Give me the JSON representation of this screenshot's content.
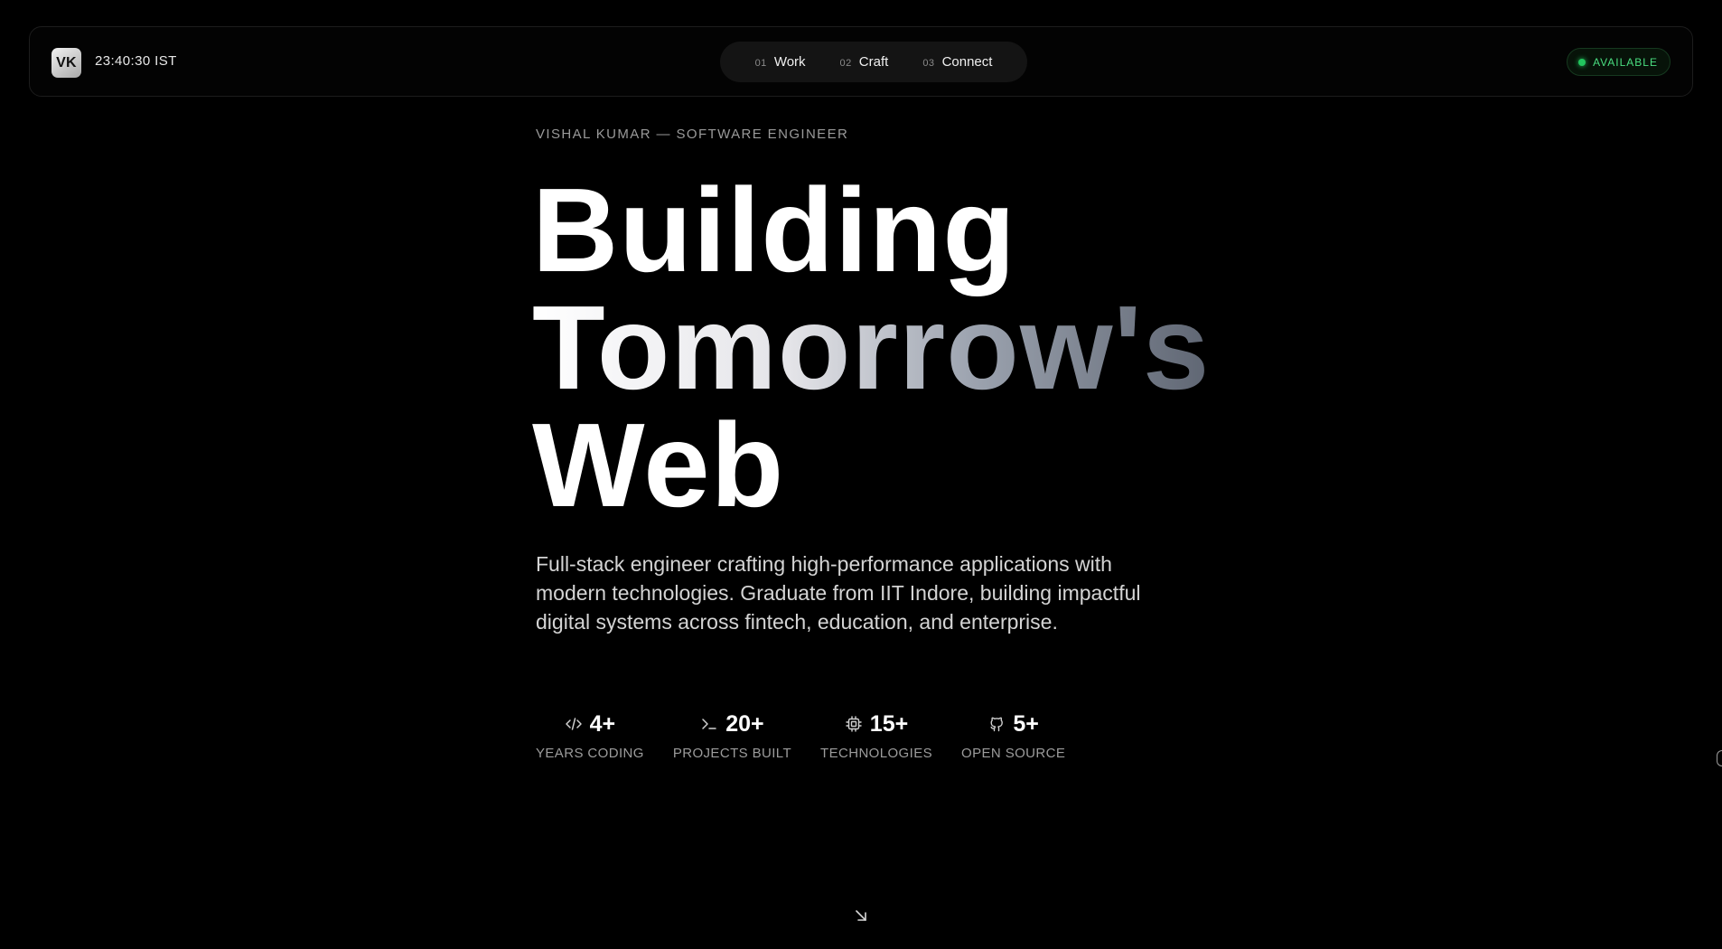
{
  "header": {
    "logo": "VK",
    "clock": "23:40:30 IST",
    "nav": [
      {
        "num": "01",
        "label": "Work"
      },
      {
        "num": "02",
        "label": "Craft"
      },
      {
        "num": "03",
        "label": "Connect"
      }
    ],
    "status": "AVAILABLE"
  },
  "hero": {
    "eyebrow": "VISHAL KUMAR — SOFTWARE ENGINEER",
    "headline": [
      "Building",
      "Tomorrow's",
      "Web"
    ],
    "lead": "Full-stack engineer crafting high-performance applications with modern technologies. Graduate from IIT Indore, building impactful digital systems across fintech, education, and enterprise."
  },
  "stats": [
    {
      "icon": "code-icon",
      "value": "4+",
      "label": "YEARS CODING"
    },
    {
      "icon": "terminal-icon",
      "value": "20+",
      "label": "PROJECTS BUILT"
    },
    {
      "icon": "cpu-icon",
      "value": "15+",
      "label": "TECHNOLOGIES"
    },
    {
      "icon": "github-icon",
      "value": "5+",
      "label": "OPEN SOURCE"
    }
  ],
  "colors": {
    "background": "#000000",
    "accent_green": "#22c55e",
    "muted_text": "#9c9c9c"
  },
  "icons": {
    "scroll": "arrow-down-right-icon"
  }
}
